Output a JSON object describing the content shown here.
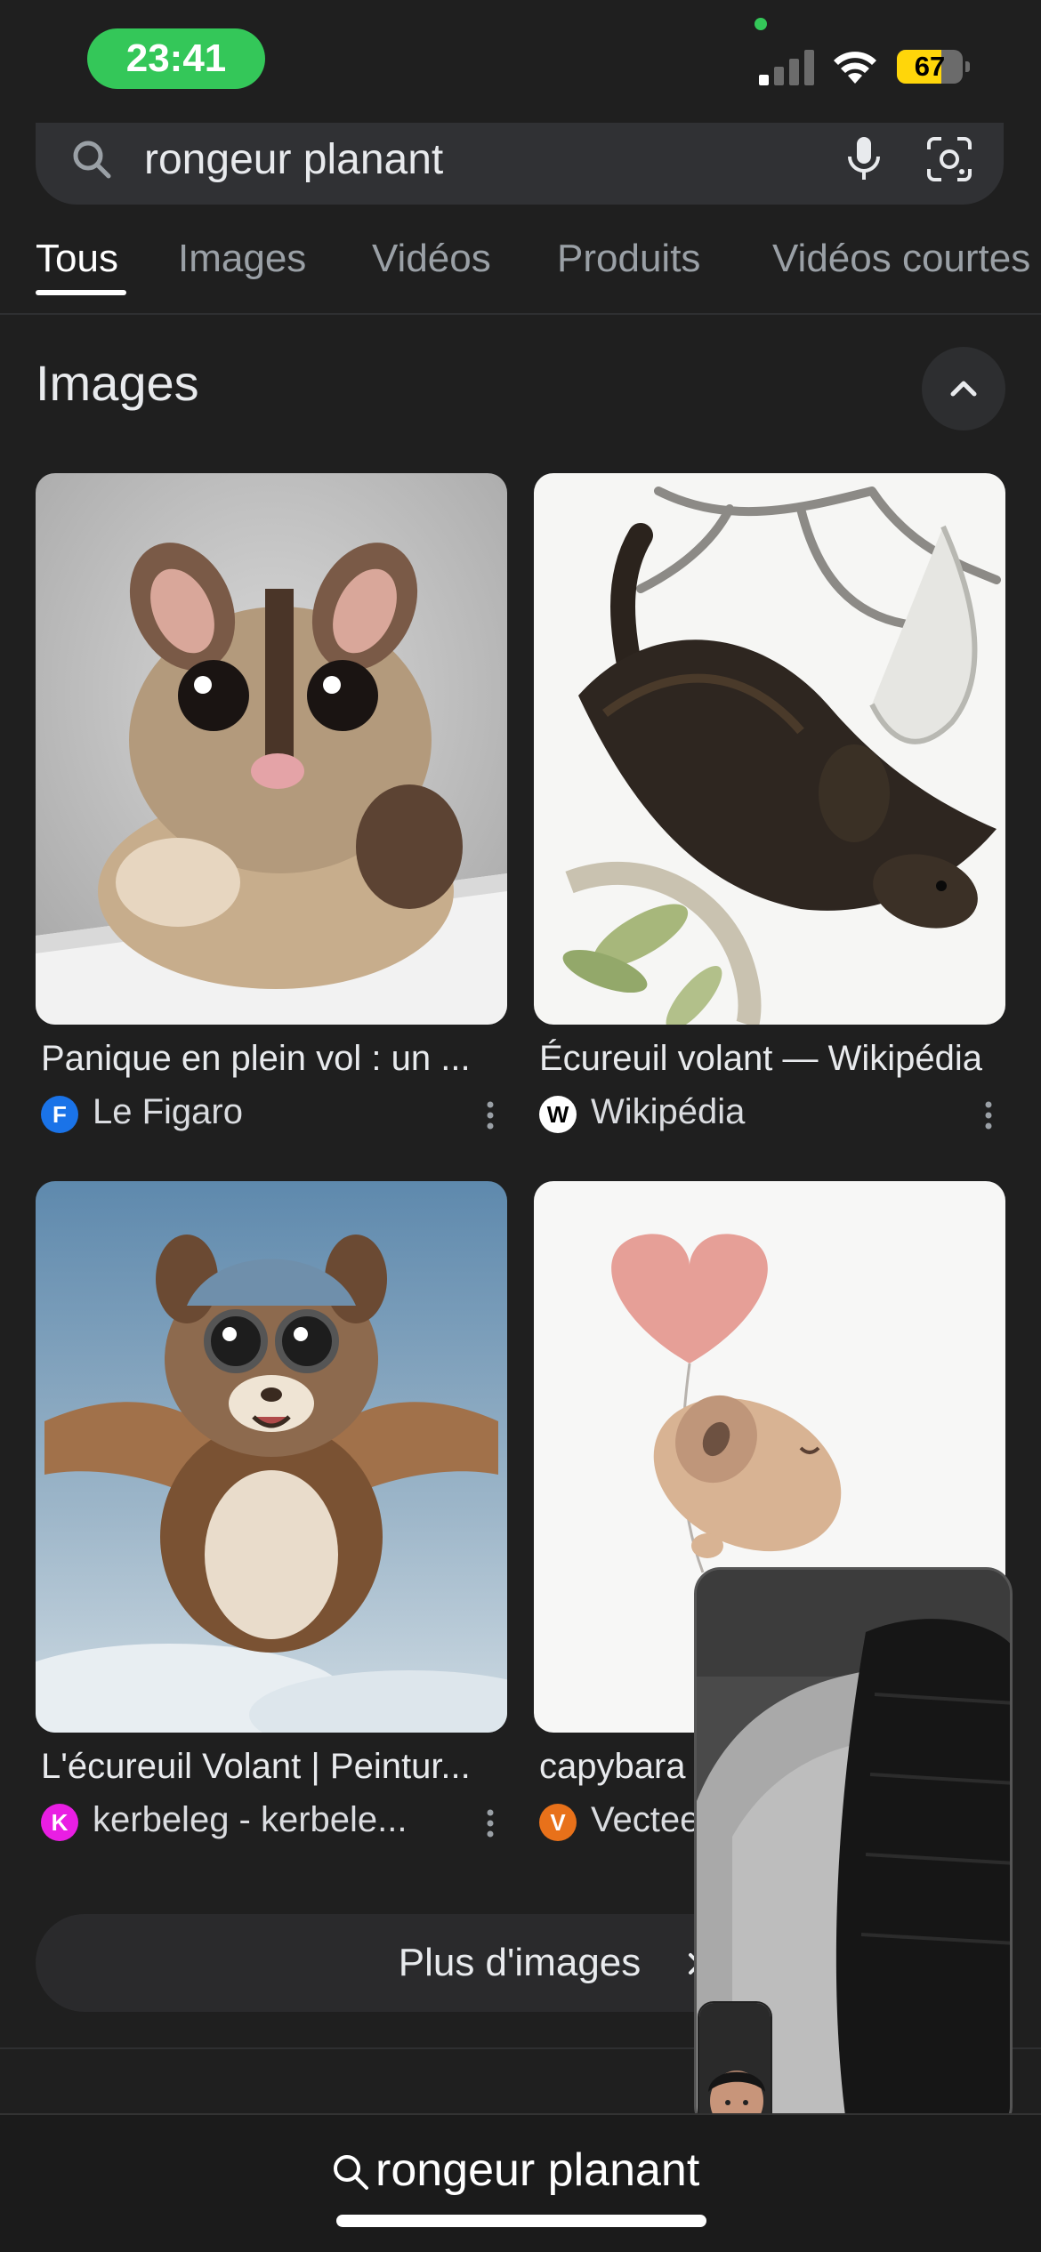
{
  "status_bar": {
    "time": "23:41",
    "battery_level": "67",
    "battery_fraction": 0.67,
    "signal_bars_active": 1,
    "signal_bars_total": 4
  },
  "search": {
    "query": "rongeur planant"
  },
  "tabs": [
    {
      "label": "Tous",
      "active": true
    },
    {
      "label": "Images",
      "active": false
    },
    {
      "label": "Vidéos",
      "active": false
    },
    {
      "label": "Produits",
      "active": false
    },
    {
      "label": "Vidéos courtes",
      "active": false
    }
  ],
  "images_section": {
    "title": "Images",
    "cards": [
      {
        "title": "Panique en plein vol : un ...",
        "source": "Le Figaro",
        "favicon_letter": "F",
        "favicon_color": "#1a73e8"
      },
      {
        "title": "Écureuil volant — Wikipédia",
        "source": "Wikipédia",
        "favicon_letter": "W",
        "favicon_color": "#ffffff"
      },
      {
        "title": "L'écureuil Volant | Peintur...",
        "source": "kerbeleg - kerbele...",
        "favicon_letter": "K",
        "favicon_color": "#e91ee3"
      },
      {
        "title": "capybara",
        "source": "Vectee",
        "favicon_letter": "V",
        "favicon_color": "#e8711a"
      }
    ],
    "more_label": "Plus d'images"
  },
  "bottom_bar": {
    "query": "rongeur planant"
  },
  "colors": {
    "background": "#1f1f1f",
    "search_bar": "#303134",
    "time_pill": "#34c759",
    "battery": "#ffd60a"
  }
}
